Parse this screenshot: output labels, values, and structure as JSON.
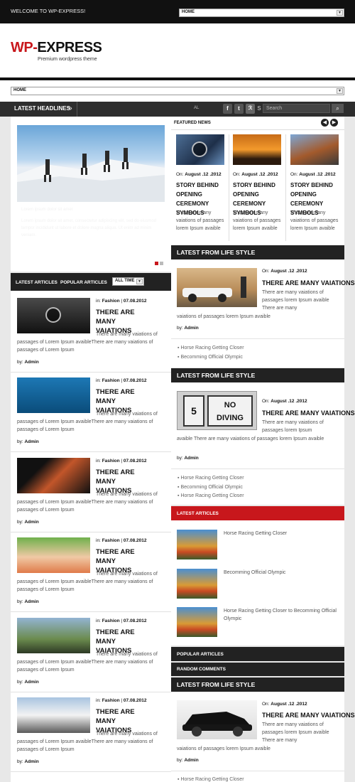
{
  "topbar": {
    "welcome": "WELCOME TO WP-EXPRESS!",
    "nav_select": "HOME"
  },
  "brand": {
    "logo_wp": "WP",
    "logo_dash": "-",
    "logo_express": "EXPRESS",
    "tagline": "Premium wordpress theme"
  },
  "main_nav": {
    "select": "HOME"
  },
  "headlines": {
    "label": "LATEST HEADLINES",
    "arrow": "»",
    "ticker": "AL",
    "search_placeholder": "Search",
    "search_icon": "search-icon"
  },
  "slider": {
    "caption_title": "Lorem ipsum dolor sit amet",
    "caption_text": "Lorem ipsum dolor sit amet, consectetur adipiscing elit, sed do eiusmod tempor incididunt ut labore et dolore magna aliqua. Ut enim ad minim veniam."
  },
  "featured": {
    "label": "FEATURED NEWS",
    "items": [
      {
        "date_prefix": "On:",
        "date": "August .12 .2012",
        "title": "STORY BEHIND OPENING CEREMONY SYMBOLS",
        "excerpt": "There are many vaiations of passages lorem Ipsum avaible"
      },
      {
        "date_prefix": "On:",
        "date": "August .12 .2012",
        "title": "STORY BEHIND OPENING CEREMONY SYMBOLS",
        "excerpt": "There are many vaiations of passages lorem Ipsum avaible"
      },
      {
        "date_prefix": "On:",
        "date": "August .12 .2012",
        "title": "STORY BEHIND OPENING CEREMONY SYMBOLS",
        "excerpt": "There are many vaiations of passages lorem Ipsum avaible"
      }
    ]
  },
  "tabs": {
    "latest": "LATEST ARTICLES",
    "popular": "POPULAR ARTICLES",
    "filter": "ALL TIME"
  },
  "articles": [
    {
      "in": "in:",
      "category": "Fashion",
      "date": "07.08.2012",
      "title": "THERE ARE MANY VAIATIONS",
      "excerpt_a": "There are many vaiations of",
      "excerpt_b": "passages of Lorem Ipsum avaibleThere are many vaiations of passages of Lorem Ipsum",
      "by": "by:",
      "author": "Admin"
    },
    {
      "in": "in:",
      "category": "Fashion",
      "date": "07.08.2012",
      "title": "THERE ARE MANY VAIATIONS",
      "excerpt_a": "There are many vaiations of",
      "excerpt_b": "passages of Lorem Ipsum avaibleThere are many vaiations of passages of Lorem Ipsum",
      "by": "by:",
      "author": "Admin"
    },
    {
      "in": "in:",
      "category": "Fashion",
      "date": "07.08.2012",
      "title": "THERE ARE MANY VAIATIONS",
      "excerpt_a": "There are many vaiations of",
      "excerpt_b": "passages of Lorem Ipsum avaibleThere are many vaiations of passages of Lorem Ipsum",
      "by": "by:",
      "author": "Admin"
    },
    {
      "in": "in:",
      "category": "Fashion",
      "date": "07.08.2012",
      "title": "THERE ARE MANY VAIATIONS",
      "excerpt_a": "There are many vaiations of",
      "excerpt_b": "passages of Lorem Ipsum avaibleThere are many vaiations of passages of Lorem Ipsum",
      "by": "by:",
      "author": "Admin"
    },
    {
      "in": "in:",
      "category": "Fashion",
      "date": "07.08.2012",
      "title": "THERE ARE MANY VAIATIONS",
      "excerpt_a": "There are many vaiations of",
      "excerpt_b": "passages of Lorem Ipsum avaibleThere are many vaiations of passages of Lorem Ipsum",
      "by": "by:",
      "author": "Admin"
    },
    {
      "in": "in:",
      "category": "Fashion",
      "date": "07.08.2012",
      "title": "THERE ARE MANY VAIATIONS",
      "excerpt_a": "There are many vaiations of",
      "excerpt_b": "passages of Lorem Ipsum avaibleThere are many vaiations of passages of Lorem Ipsum",
      "by": "by:",
      "author": "Admin"
    }
  ],
  "life1": {
    "heading": "LATEST FROM LIFE STYLE",
    "date_prefix": "On:",
    "date": "August .12 .2012",
    "title": "THERE ARE MANY VAIATIONS",
    "excerpt_a": "There are many vaiations of passages lorem Ipsum avaible There are many",
    "excerpt_b": "vaiations of passages lorem Ipsum avaible",
    "by": "by:",
    "author": "Admin",
    "links": [
      "Horse Racing Getting Closer",
      "Becomming Official Olympic"
    ]
  },
  "life2": {
    "heading": "LATEST FROM LIFE STYLE",
    "date_prefix": "On:",
    "date": "August .12 .2012",
    "title": "THERE ARE MANY VAIATIONS",
    "excerpt_a": "There are many vaiations of passages lorem Ipsum",
    "excerpt_b": "avaible There are many vaiations of passages lorem Ipsum avaible",
    "by": "by:",
    "author": "Admin",
    "links": [
      "Horse Racing Getting Closer",
      "Becomming Official Olympic",
      "Horse Racing Getting Closer"
    ],
    "sign_text": "5FT NO DIVING"
  },
  "sidebar_latest": {
    "heading": "LATEST ARTICLES",
    "items": [
      "Horse Racing Getting Closer",
      "Becomming Official Olympic",
      "Horse Racing Getting Closer to Becomming Official Olympic"
    ]
  },
  "popular_heading": "POPULAR ARTICLES",
  "comments_heading": "RANDOM COMMENTS",
  "life3": {
    "heading": "LATEST FROM LIFE STYLE",
    "date_prefix": "On:",
    "date": "August .12 .2012",
    "title": "THERE ARE MANY VAIATIONS",
    "excerpt_a": "There are many vaiations of passages lorem Ipsum avaible There are many",
    "excerpt_b": "vaiations of passages lorem Ipsum avaible",
    "by": "by:",
    "author": "Admin",
    "links": [
      "Horse Racing Getting Closer"
    ]
  },
  "colors": {
    "brand_red": "#c8171c",
    "dark": "#222222"
  }
}
